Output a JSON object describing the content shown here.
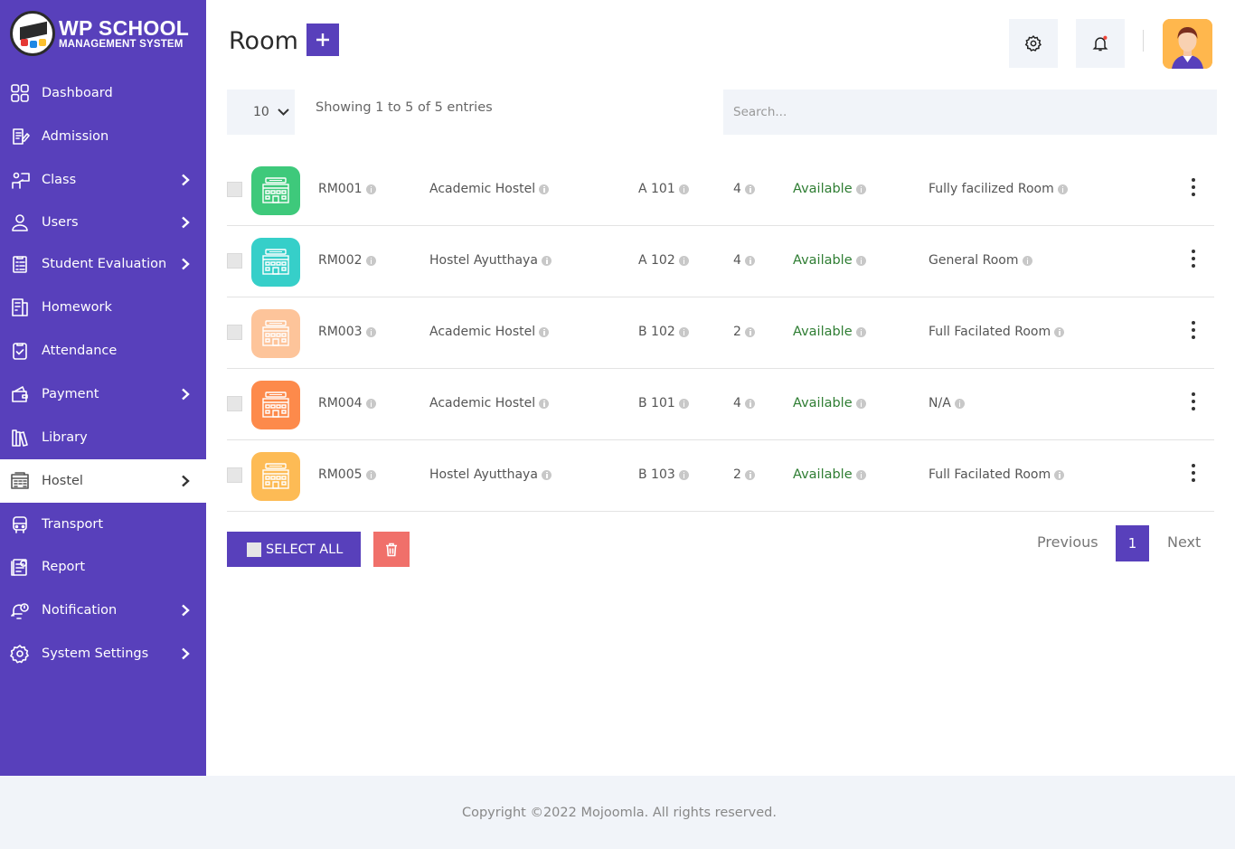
{
  "brand": {
    "title": "WP SCHOOL",
    "subtitle": "MANAGEMENT SYSTEM"
  },
  "sidebar": {
    "items": [
      {
        "label": "Dashboard",
        "icon": "dashboard-icon",
        "has_submenu": false,
        "active": false
      },
      {
        "label": "Admission",
        "icon": "admission-icon",
        "has_submenu": false,
        "active": false
      },
      {
        "label": "Class",
        "icon": "class-icon",
        "has_submenu": true,
        "active": false
      },
      {
        "label": "Users",
        "icon": "users-icon",
        "has_submenu": true,
        "active": false
      },
      {
        "label": "Student Evaluation",
        "icon": "evaluation-icon",
        "has_submenu": true,
        "active": false
      },
      {
        "label": "Homework",
        "icon": "homework-icon",
        "has_submenu": false,
        "active": false
      },
      {
        "label": "Attendance",
        "icon": "attendance-icon",
        "has_submenu": false,
        "active": false
      },
      {
        "label": "Payment",
        "icon": "payment-icon",
        "has_submenu": true,
        "active": false
      },
      {
        "label": "Library",
        "icon": "library-icon",
        "has_submenu": false,
        "active": false
      },
      {
        "label": "Hostel",
        "icon": "hostel-icon",
        "has_submenu": true,
        "active": true
      },
      {
        "label": "Transport",
        "icon": "transport-icon",
        "has_submenu": false,
        "active": false
      },
      {
        "label": "Report",
        "icon": "report-icon",
        "has_submenu": false,
        "active": false
      },
      {
        "label": "Notification",
        "icon": "notification-icon",
        "has_submenu": true,
        "active": false
      },
      {
        "label": "System Settings",
        "icon": "system-settings-icon",
        "has_submenu": true,
        "active": false
      }
    ]
  },
  "header": {
    "title": "Room"
  },
  "table_controls": {
    "page_length": "10",
    "info": "Showing 1 to 5 of 5 entries",
    "search_placeholder": "Search..."
  },
  "rows": [
    {
      "id": "RM001",
      "hostel": "Academic Hostel",
      "room": "A 101",
      "beds": "4",
      "status": "Available",
      "description": "Fully facilized Room",
      "icon_color": "#3ec97b"
    },
    {
      "id": "RM002",
      "hostel": "Hostel Ayutthaya",
      "room": "A 102",
      "beds": "4",
      "status": "Available",
      "description": "General Room",
      "icon_color": "#36cfc9"
    },
    {
      "id": "RM003",
      "hostel": "Academic Hostel",
      "room": "B 102",
      "beds": "2",
      "status": "Available",
      "description": "Full Facilated Room",
      "icon_color": "#fdc49a"
    },
    {
      "id": "RM004",
      "hostel": "Academic Hostel",
      "room": "B 101",
      "beds": "4",
      "status": "Available",
      "description": "N/A",
      "icon_color": "#fd8a4b"
    },
    {
      "id": "RM005",
      "hostel": "Hostel Ayutthaya",
      "room": "B 103",
      "beds": "2",
      "status": "Available",
      "description": "Full Facilated Room",
      "icon_color": "#fdbb55"
    }
  ],
  "actions": {
    "select_all": "SELECT ALL"
  },
  "pagination": {
    "previous": "Previous",
    "current": "1",
    "next": "Next"
  },
  "footer": {
    "copyright": "Copyright ©2022 Mojoomla. All rights reserved."
  },
  "colors": {
    "primary": "#5840bb",
    "status_available": "#2e7d32",
    "delete": "#f0706a"
  }
}
